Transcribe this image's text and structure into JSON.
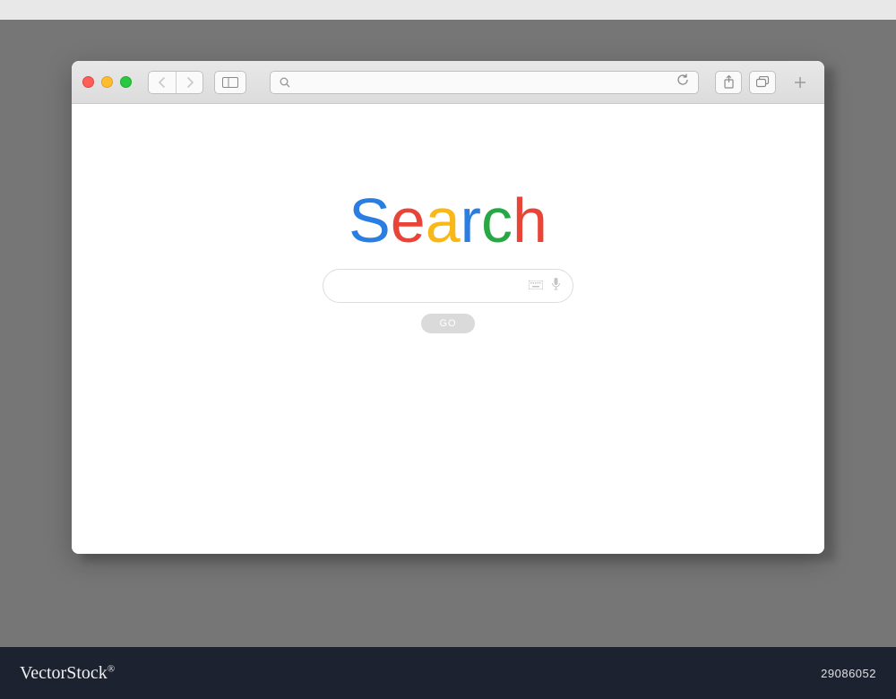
{
  "browser": {
    "address_bar": {
      "value": "",
      "placeholder": ""
    }
  },
  "page": {
    "logo": {
      "letters": [
        "S",
        "e",
        "a",
        "r",
        "c",
        "h"
      ],
      "colors": [
        "#2a7de1",
        "#e84438",
        "#f8b817",
        "#2a7de1",
        "#28a745",
        "#e84438"
      ]
    },
    "search": {
      "value": "",
      "placeholder": ""
    },
    "go_label": "GO"
  },
  "footer": {
    "left_brand_1": "Vector",
    "left_brand_2": "Stock",
    "left_brand_r": "®",
    "right_id": "29086052"
  }
}
